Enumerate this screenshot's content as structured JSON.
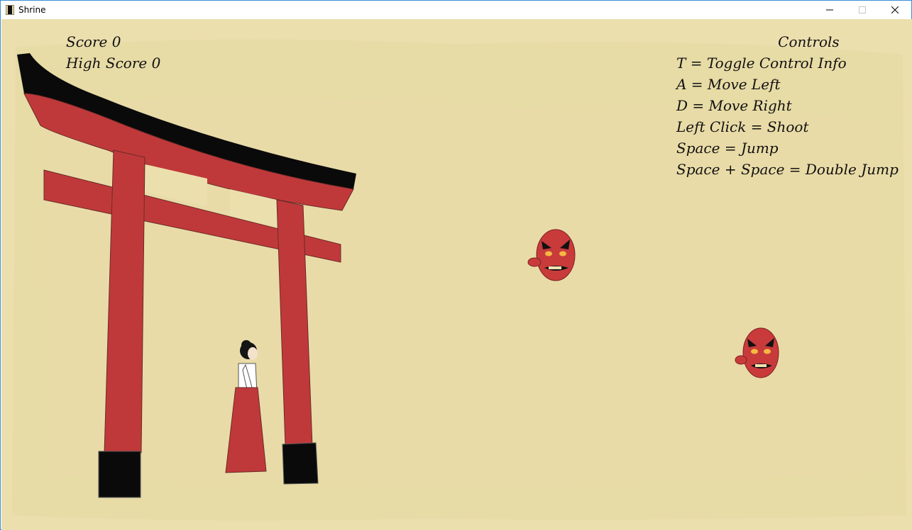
{
  "window": {
    "title": "Shrine",
    "controls": [
      "minimize",
      "maximize",
      "close"
    ]
  },
  "hud": {
    "score_label": "Score",
    "score_value": "0",
    "score_text": "Score 0",
    "high_score_text": "High Score 0"
  },
  "controls_panel": {
    "heading": "Controls",
    "lines": [
      "T = Toggle Control Info",
      "A = Move Left",
      "D = Move Right",
      "Left Click = Shoot",
      "Space = Jump",
      "Space + Space = Double Jump"
    ]
  },
  "colors": {
    "background": "#e8dca8",
    "torii_red": "#c0393a",
    "torii_black": "#0a0a0a",
    "mask_red": "#c93b3b"
  },
  "icons": {
    "app": "app-icon",
    "minimize": "minimize-icon",
    "maximize": "maximize-icon",
    "close": "close-icon"
  }
}
